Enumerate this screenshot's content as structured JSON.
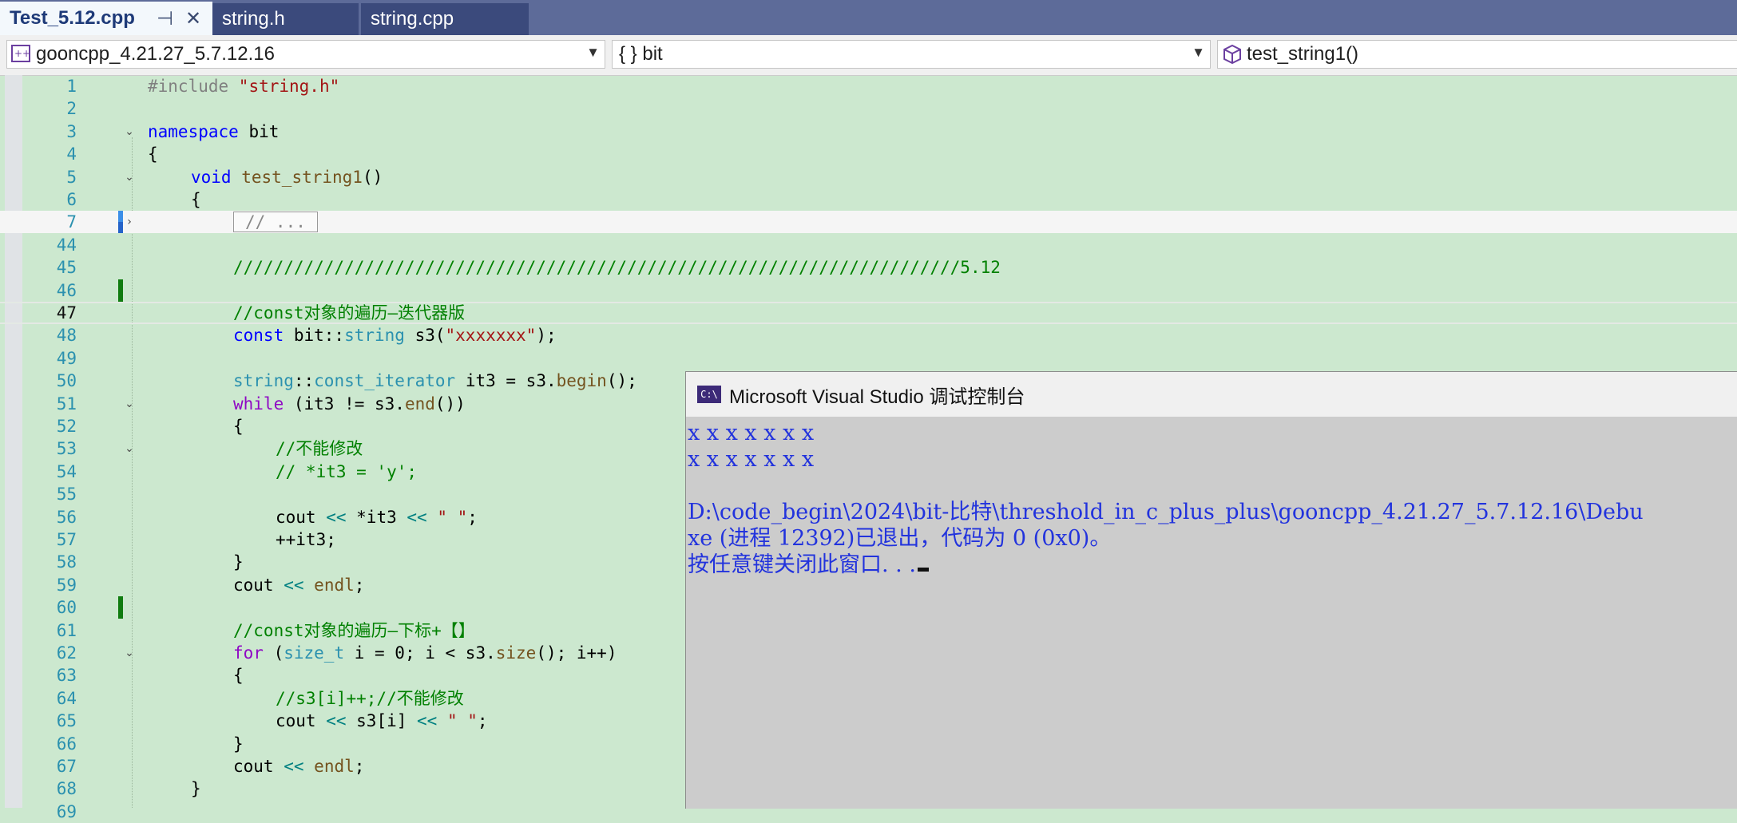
{
  "tabs": [
    {
      "label": "Test_5.12.cpp",
      "active": true
    },
    {
      "label": "string.h",
      "active": false
    },
    {
      "label": "string.cpp",
      "active": false
    }
  ],
  "navbar": {
    "project": "gooncpp_4.21.27_5.7.12.16",
    "scope": "{ } bit",
    "member": "test_string1()"
  },
  "editor": {
    "current_line": "47",
    "lines": [
      {
        "n": "1",
        "indent": 0,
        "tokens": [
          [
            "pp",
            "#include "
          ],
          [
            "str",
            "\"string.h\""
          ]
        ]
      },
      {
        "n": "2",
        "indent": 0,
        "tokens": []
      },
      {
        "n": "3",
        "indent": 0,
        "fold": "v",
        "tokens": [
          [
            "kw",
            "namespace"
          ],
          [
            "",
            " bit"
          ]
        ]
      },
      {
        "n": "4",
        "indent": 0,
        "tokens": [
          [
            "",
            "{"
          ]
        ]
      },
      {
        "n": "5",
        "indent": 1,
        "fold": "v",
        "tokens": [
          [
            "kw",
            "void"
          ],
          [
            "",
            " "
          ],
          [
            "fn",
            "test_string1"
          ],
          [
            "",
            "()"
          ]
        ]
      },
      {
        "n": "6",
        "indent": 1,
        "tokens": [
          [
            "",
            "{"
          ]
        ]
      },
      {
        "n": "7",
        "indent": 2,
        "fold": ">",
        "collapsed": "// ...",
        "change": "mixed",
        "tokens": []
      },
      {
        "n": "44",
        "indent": 2,
        "tokens": []
      },
      {
        "n": "45",
        "indent": 2,
        "tokens": [
          [
            "cm",
            "////////////////////////////////////////////////////////////////////////5.12"
          ]
        ]
      },
      {
        "n": "46",
        "indent": 2,
        "change": "saved",
        "tokens": []
      },
      {
        "n": "47",
        "indent": 2,
        "tokens": [
          [
            "cm",
            "//const对象的遍历—迭代器版"
          ]
        ]
      },
      {
        "n": "48",
        "indent": 2,
        "tokens": [
          [
            "kw",
            "const"
          ],
          [
            "",
            " bit::"
          ],
          [
            "ty",
            "string"
          ],
          [
            "",
            " s3("
          ],
          [
            "str",
            "\"xxxxxxx\""
          ],
          [
            "",
            ");"
          ]
        ]
      },
      {
        "n": "49",
        "indent": 2,
        "tokens": []
      },
      {
        "n": "50",
        "indent": 2,
        "tokens": [
          [
            "ty",
            "string"
          ],
          [
            "",
            "::"
          ],
          [
            "ty",
            "const_iterator"
          ],
          [
            "",
            " it3 = s3."
          ],
          [
            "fn",
            "begin"
          ],
          [
            "",
            "();"
          ]
        ]
      },
      {
        "n": "51",
        "indent": 2,
        "fold": "v",
        "tokens": [
          [
            "ctl",
            "while"
          ],
          [
            "",
            " (it3 != s3."
          ],
          [
            "fn",
            "end"
          ],
          [
            "",
            "())"
          ]
        ]
      },
      {
        "n": "52",
        "indent": 2,
        "tokens": [
          [
            "",
            "{"
          ]
        ]
      },
      {
        "n": "53",
        "indent": 3,
        "fold": "v",
        "tokens": [
          [
            "cm",
            "//不能修改"
          ]
        ]
      },
      {
        "n": "54",
        "indent": 3,
        "tokens": [
          [
            "cm",
            "// *it3 = 'y';"
          ]
        ]
      },
      {
        "n": "55",
        "indent": 3,
        "tokens": []
      },
      {
        "n": "56",
        "indent": 3,
        "tokens": [
          [
            "",
            "cout "
          ],
          [
            "op",
            "<<"
          ],
          [
            "",
            " *it3 "
          ],
          [
            "op",
            "<<"
          ],
          [
            "",
            " "
          ],
          [
            "str",
            "\" \""
          ],
          [
            "",
            ";"
          ]
        ]
      },
      {
        "n": "57",
        "indent": 3,
        "tokens": [
          [
            "",
            "++it3;"
          ]
        ]
      },
      {
        "n": "58",
        "indent": 2,
        "tokens": [
          [
            "",
            "}"
          ]
        ]
      },
      {
        "n": "59",
        "indent": 2,
        "tokens": [
          [
            "",
            "cout "
          ],
          [
            "op",
            "<<"
          ],
          [
            "",
            " "
          ],
          [
            "fn",
            "endl"
          ],
          [
            "",
            ";"
          ]
        ]
      },
      {
        "n": "60",
        "indent": 2,
        "change": "saved",
        "tokens": []
      },
      {
        "n": "61",
        "indent": 2,
        "tokens": [
          [
            "cm",
            "//const对象的遍历—下标+【】"
          ]
        ]
      },
      {
        "n": "62",
        "indent": 2,
        "fold": "v",
        "tokens": [
          [
            "ctl",
            "for"
          ],
          [
            "",
            " ("
          ],
          [
            "ty",
            "size_t"
          ],
          [
            "",
            " i = 0; i < s3."
          ],
          [
            "fn",
            "size"
          ],
          [
            "",
            "(); i++)"
          ]
        ]
      },
      {
        "n": "63",
        "indent": 2,
        "tokens": [
          [
            "",
            "{"
          ]
        ]
      },
      {
        "n": "64",
        "indent": 3,
        "tokens": [
          [
            "cm",
            "//s3[i]++;//不能修改"
          ]
        ]
      },
      {
        "n": "65",
        "indent": 3,
        "tokens": [
          [
            "",
            "cout "
          ],
          [
            "op",
            "<<"
          ],
          [
            "",
            " s3[i] "
          ],
          [
            "op",
            "<<"
          ],
          [
            "",
            " "
          ],
          [
            "str",
            "\" \""
          ],
          [
            "",
            ";"
          ]
        ]
      },
      {
        "n": "66",
        "indent": 2,
        "tokens": [
          [
            "",
            "}"
          ]
        ]
      },
      {
        "n": "67",
        "indent": 2,
        "tokens": [
          [
            "",
            "cout "
          ],
          [
            "op",
            "<<"
          ],
          [
            "",
            " "
          ],
          [
            "fn",
            "endl"
          ],
          [
            "",
            ";"
          ]
        ]
      },
      {
        "n": "68",
        "indent": 1,
        "tokens": [
          [
            "",
            "}"
          ]
        ]
      },
      {
        "n": "69",
        "indent": 0,
        "tokens": []
      }
    ]
  },
  "console": {
    "icon_text": "C:\\",
    "title": "Microsoft Visual Studio 调试控制台",
    "lines": [
      "x x x x x x x",
      "x x x x x x x",
      "",
      "D:\\code_begin\\2024\\bit-比特\\threshold_in_c_plus_plus\\gooncpp_4.21.27_5.7.12.16\\Debu",
      "xe (进程 12392)已退出，代码为 0 (0x0)。",
      "按任意键关闭此窗口. . ."
    ]
  }
}
